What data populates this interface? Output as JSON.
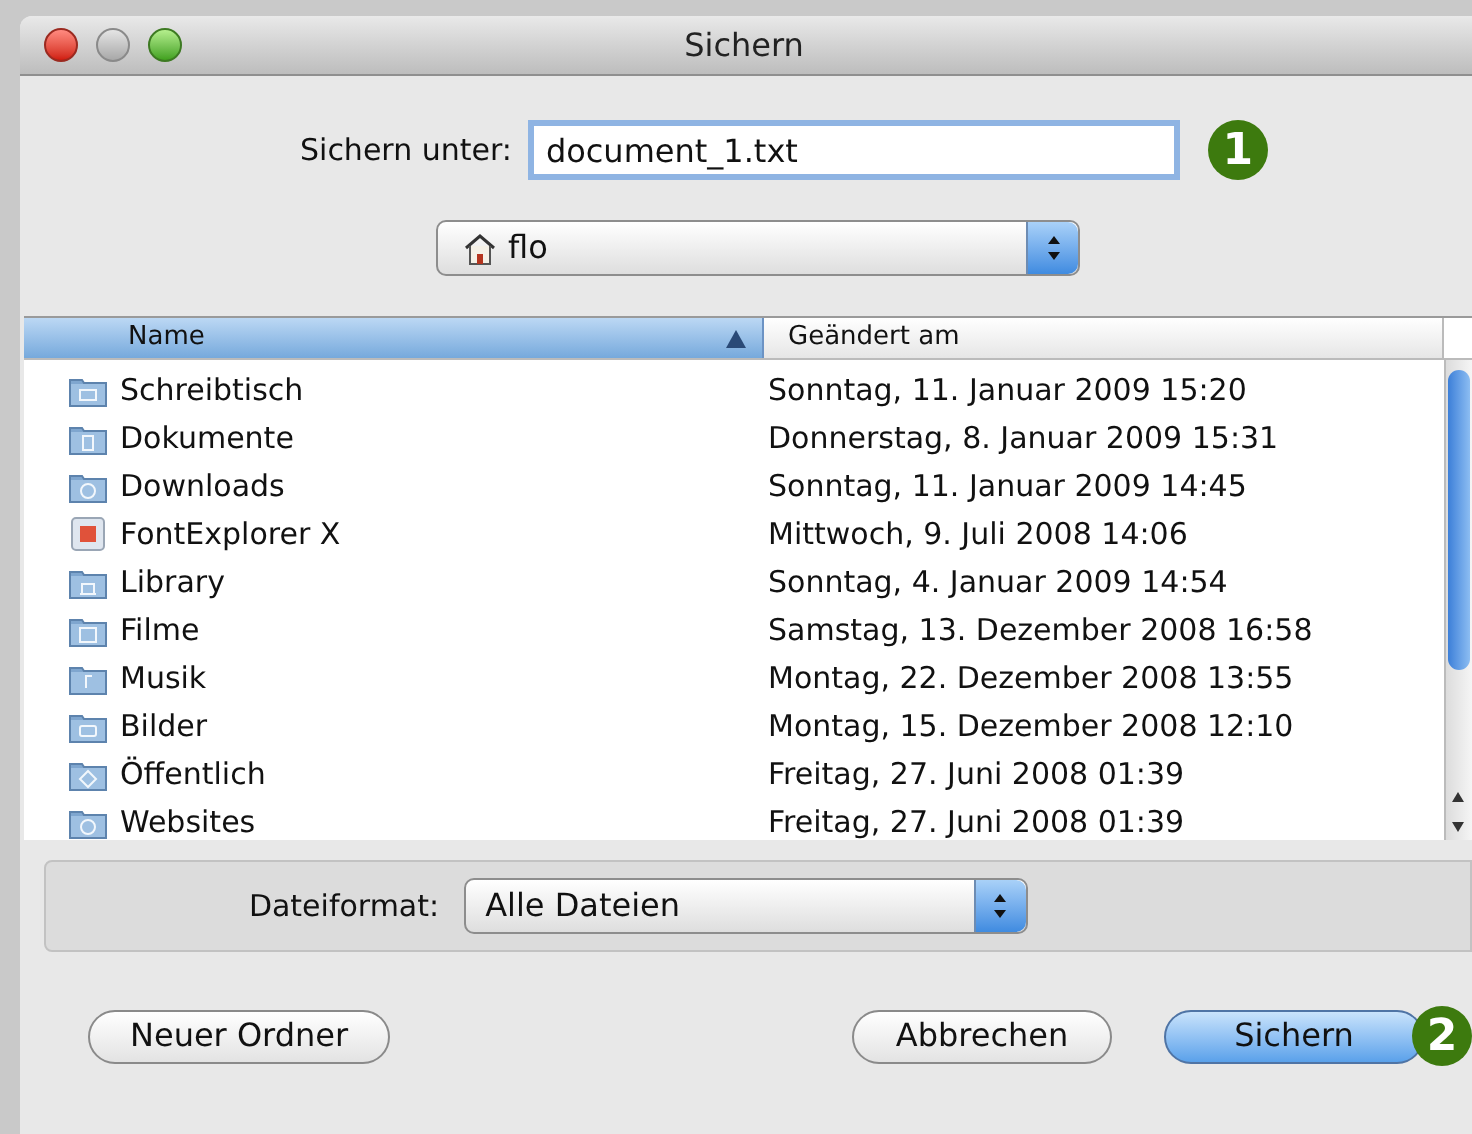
{
  "window": {
    "title": "Sichern"
  },
  "save_as": {
    "label": "Sichern unter:",
    "value": "document_1.txt",
    "badge": "1"
  },
  "location": {
    "value": "flo"
  },
  "table": {
    "columns": [
      {
        "label": "Name",
        "selected": true
      },
      {
        "label": "Geändert am",
        "selected": false
      }
    ],
    "rows": [
      {
        "name": "Schreibtisch",
        "modified": "Sonntag, 11. Januar 2009 15:20",
        "kind": "desktop"
      },
      {
        "name": "Dokumente",
        "modified": "Donnerstag, 8. Januar 2009 15:31",
        "kind": "documents"
      },
      {
        "name": "Downloads",
        "modified": "Sonntag, 11. Januar 2009 14:45",
        "kind": "downloads"
      },
      {
        "name": "FontExplorer X",
        "modified": "Mittwoch, 9. Juli 2008 14:06",
        "kind": "app"
      },
      {
        "name": "Library",
        "modified": "Sonntag, 4. Januar 2009 14:54",
        "kind": "library"
      },
      {
        "name": "Filme",
        "modified": "Samstag, 13. Dezember 2008 16:58",
        "kind": "movies"
      },
      {
        "name": "Musik",
        "modified": "Montag, 22. Dezember 2008 13:55",
        "kind": "music"
      },
      {
        "name": "Bilder",
        "modified": "Montag, 15. Dezember 2008 12:10",
        "kind": "pictures"
      },
      {
        "name": "Öffentlich",
        "modified": "Freitag, 27. Juni 2008 01:39",
        "kind": "public"
      },
      {
        "name": "Websites",
        "modified": "Freitag, 27. Juni 2008 01:39",
        "kind": "sites"
      }
    ]
  },
  "file_format": {
    "label": "Dateiformat:",
    "value": "Alle Dateien"
  },
  "buttons": [
    {
      "label": "Neuer Ordner",
      "kind": "normal"
    },
    {
      "label": "Abbrechen",
      "kind": "normal"
    },
    {
      "label": "Sichern",
      "kind": "default",
      "badge": "2"
    }
  ]
}
